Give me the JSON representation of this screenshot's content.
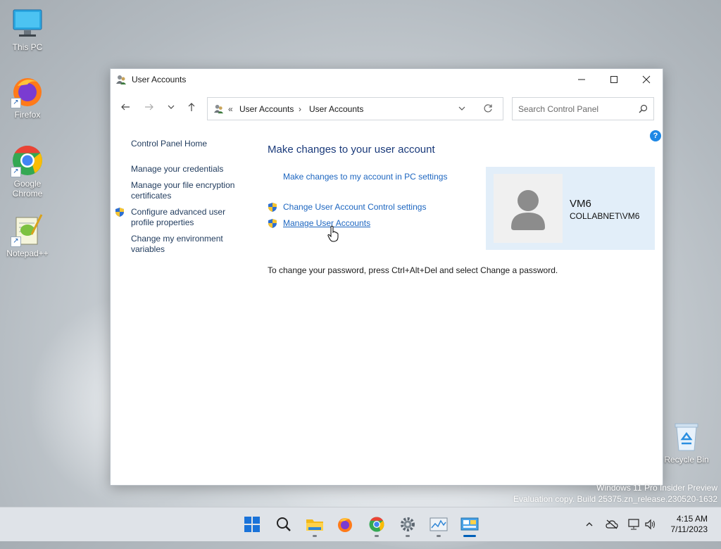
{
  "desktop": {
    "icons": [
      {
        "label": "This PC",
        "icon": "this-pc-icon"
      },
      {
        "label": "Firefox",
        "icon": "firefox-icon"
      },
      {
        "label": "Google Chrome",
        "icon": "chrome-icon"
      },
      {
        "label": "Notepad++",
        "icon": "notepadpp-icon"
      },
      {
        "label": "Recycle Bin",
        "icon": "recycle-bin-icon"
      }
    ],
    "watermark": {
      "line1": "Windows 11 Pro Insider Preview",
      "line2": "Evaluation copy. Build 25375.zn_release.230520-1632"
    }
  },
  "window": {
    "title": "User Accounts",
    "controls": [
      "minimize",
      "maximize",
      "close"
    ]
  },
  "address_bar": {
    "overflow": "«",
    "crumbs": [
      "User Accounts",
      "User Accounts"
    ],
    "separator": "›"
  },
  "search": {
    "placeholder": "Search Control Panel"
  },
  "left_nav": {
    "home": "Control Panel Home",
    "links": [
      {
        "label": "Manage your credentials"
      },
      {
        "label": "Manage your file encryption certificates"
      },
      {
        "label": "Configure advanced user profile properties",
        "shield": true
      },
      {
        "label": "Change my environment variables"
      }
    ]
  },
  "main": {
    "title": "Make changes to your user account",
    "pc_settings_link": "Make changes to my account in PC settings",
    "uac_link": "Change User Account Control settings",
    "manage_link": "Manage User Accounts",
    "password_msg": "To change your password, press Ctrl+Alt+Del and select Change a password."
  },
  "user": {
    "name": "VM6",
    "domain": "COLLABNET\\VM6"
  },
  "help": "?",
  "taskbar": {
    "apps": [
      "start",
      "search",
      "file-explorer",
      "firefox",
      "chrome",
      "settings",
      "performance-monitor",
      "control-panel"
    ],
    "time": "4:15 AM",
    "date": "7/11/2023"
  },
  "colors": {
    "link": "#1d66c0",
    "title": "#1a3a7a",
    "accent": "#005fb8",
    "user_card": "#e2eef9"
  }
}
